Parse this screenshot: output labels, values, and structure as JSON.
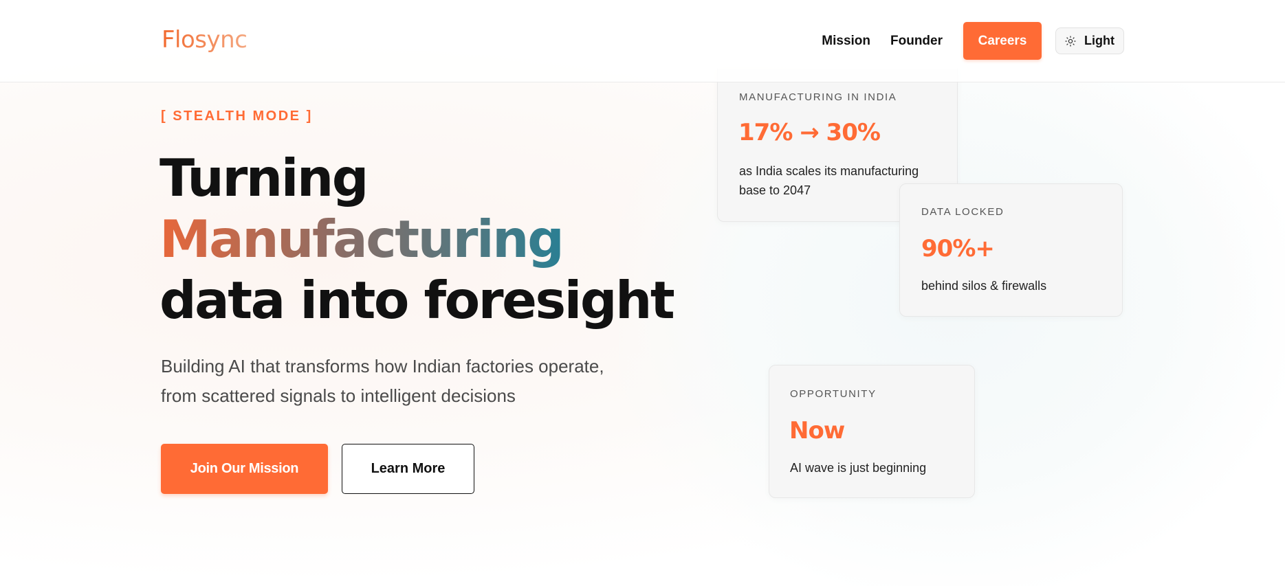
{
  "brand": {
    "logo": "Flosync"
  },
  "nav": {
    "links": [
      "Mission",
      "Founder"
    ],
    "careers_label": "Careers",
    "theme_label": "Light",
    "theme_icon": "sun-icon"
  },
  "hero": {
    "eyebrow": "[ STEALTH MODE ]",
    "headline_line1": "Turning",
    "headline_line2": "Manufacturing",
    "headline_line3": "data into foresight",
    "subtext_line1": "Building AI that transforms how Indian factories operate,",
    "subtext_line2": "from scattered signals to intelligent decisions",
    "primary_cta": "Join Our Mission",
    "secondary_cta": "Learn More"
  },
  "cards": [
    {
      "label": "MANUFACTURING IN INDIA",
      "stat": "17% → 30%",
      "desc_line1": "as India scales its manufacturing",
      "desc_line2": "base to 2047"
    },
    {
      "label": "DATA LOCKED",
      "stat": "90%+",
      "desc_line1": "behind silos & firewalls"
    },
    {
      "label": "OPPORTUNITY",
      "stat": "Now",
      "desc_line1": "AI wave is just beginning"
    }
  ],
  "colors": {
    "accent": "#ff6b35",
    "text": "#111111",
    "gradient_start": "#e8673a",
    "gradient_end": "#2a7f93"
  }
}
